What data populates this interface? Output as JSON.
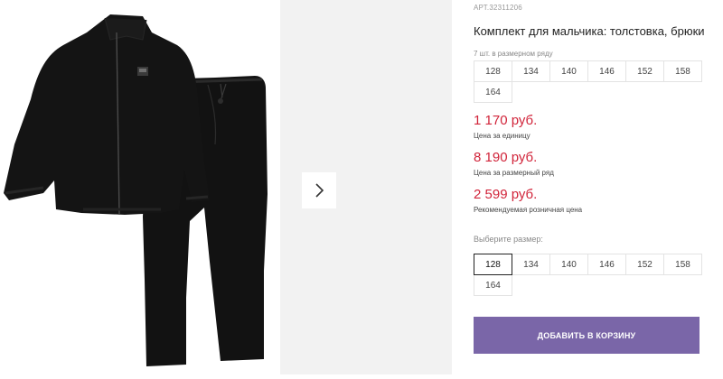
{
  "product": {
    "article_label": "АРТ.",
    "article_number": "32311206",
    "title": "Комплект для мальчика: толстовка, брюки"
  },
  "gallery": {
    "main_image": "black zip jacket and trousers set",
    "next_icon": "chevron-right-icon"
  },
  "size_range": {
    "note": "7 шт. в размерном ряду",
    "sizes": [
      "128",
      "134",
      "140",
      "146",
      "152",
      "158",
      "164"
    ]
  },
  "prices": [
    {
      "value": "1 170 руб.",
      "caption": "Цена за единицу"
    },
    {
      "value": "8 190 руб.",
      "caption": "Цена за размерный ряд"
    },
    {
      "value": "2 599 руб.",
      "caption": "Рекомендуемая розничная цена"
    }
  ],
  "size_select": {
    "label": "Выберите размер:",
    "sizes": [
      "128",
      "134",
      "140",
      "146",
      "152",
      "158",
      "164"
    ],
    "selected": "128"
  },
  "cart": {
    "button_label": "ДОБАВИТЬ В КОРЗИНУ"
  },
  "colors": {
    "price": "#d1243a",
    "button": "#7a66a8",
    "placeholder": "#f2f2f2"
  }
}
